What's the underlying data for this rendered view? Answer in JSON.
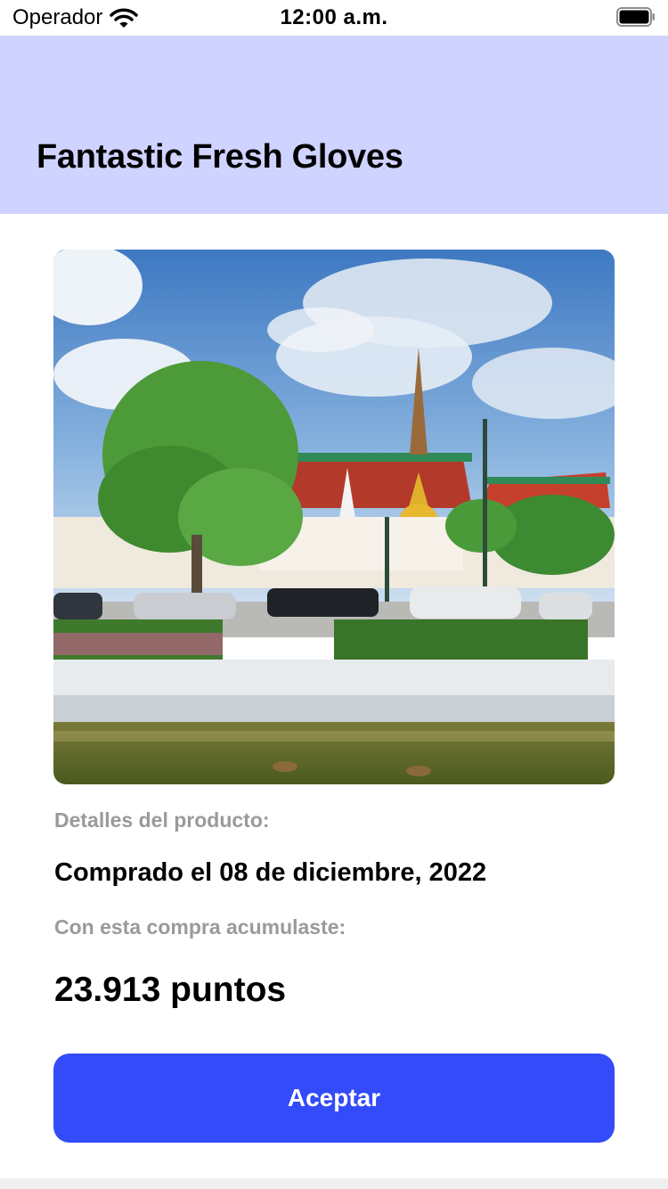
{
  "status_bar": {
    "carrier": "Operador",
    "time": "12:00 a.m.",
    "icons": [
      "wifi-icon",
      "battery-icon"
    ]
  },
  "header": {
    "title": "Fantastic Fresh Gloves",
    "background_color": "#cfd3ff"
  },
  "product": {
    "image_subject": "temple-street-photo",
    "details_label": "Detalles del producto:",
    "purchase_date": "Comprado el 08 de diciembre, 2022",
    "accumulated_label": "Con esta compra acumulaste:",
    "points": "23.913 puntos"
  },
  "actions": {
    "accept_label": "Aceptar",
    "accent_color": "#334bf9"
  }
}
